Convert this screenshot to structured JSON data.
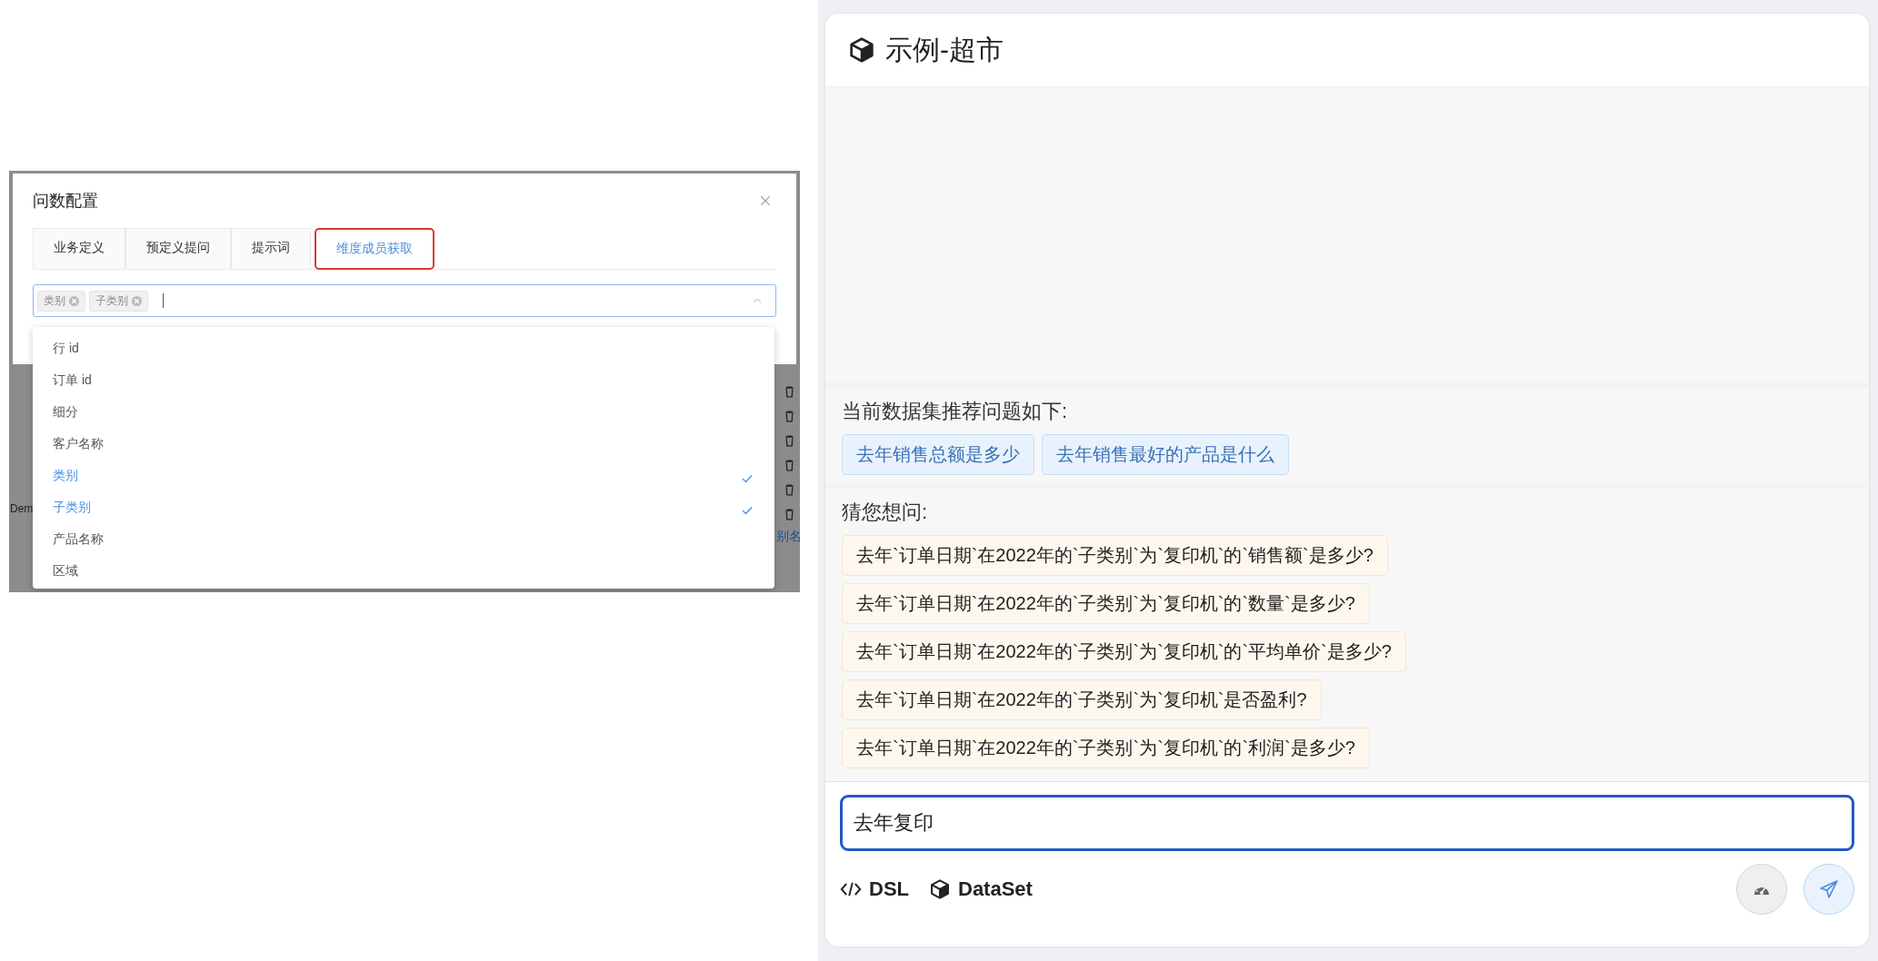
{
  "config_dialog": {
    "title": "问数配置",
    "tabs": [
      {
        "label": "业务定义",
        "selected": false
      },
      {
        "label": "预定义提问",
        "selected": false
      },
      {
        "label": "提示词",
        "selected": false
      },
      {
        "label": "维度成员获取",
        "selected": true
      }
    ],
    "select": {
      "tags": [
        "类别",
        "子类别"
      ]
    },
    "options": [
      {
        "label": "行 id",
        "selected": false
      },
      {
        "label": "订单 id",
        "selected": false
      },
      {
        "label": "细分",
        "selected": false
      },
      {
        "label": "客户名称",
        "selected": false
      },
      {
        "label": "类别",
        "selected": true
      },
      {
        "label": "子类别",
        "selected": true
      },
      {
        "label": "产品名称",
        "selected": false
      },
      {
        "label": "区域",
        "selected": false
      }
    ],
    "background_fragments": [
      "Dem",
      "别名"
    ]
  },
  "chat": {
    "title": "示例-超市",
    "recommend": {
      "heading": "当前数据集推荐问题如下:",
      "questions": [
        "去年销售总额是多少",
        "去年销售最好的产品是什么"
      ]
    },
    "guess": {
      "heading": "猜您想问:",
      "questions": [
        "去年`订单日期`在2022年的`子类别`为`复印机`的`销售额`是多少?",
        "去年`订单日期`在2022年的`子类别`为`复印机`的`数量`是多少?",
        "去年`订单日期`在2022年的`子类别`为`复印机`的`平均单价`是多少?",
        "去年`订单日期`在2022年的`子类别`为`复印机`是否盈利?",
        "去年`订单日期`在2022年的`子类别`为`复印机`的`利润`是多少?"
      ]
    },
    "input": {
      "value": "去年复印"
    },
    "tools": [
      {
        "kind": "code",
        "label": "DSL"
      },
      {
        "kind": "dataset",
        "label": "DataSet"
      }
    ]
  }
}
